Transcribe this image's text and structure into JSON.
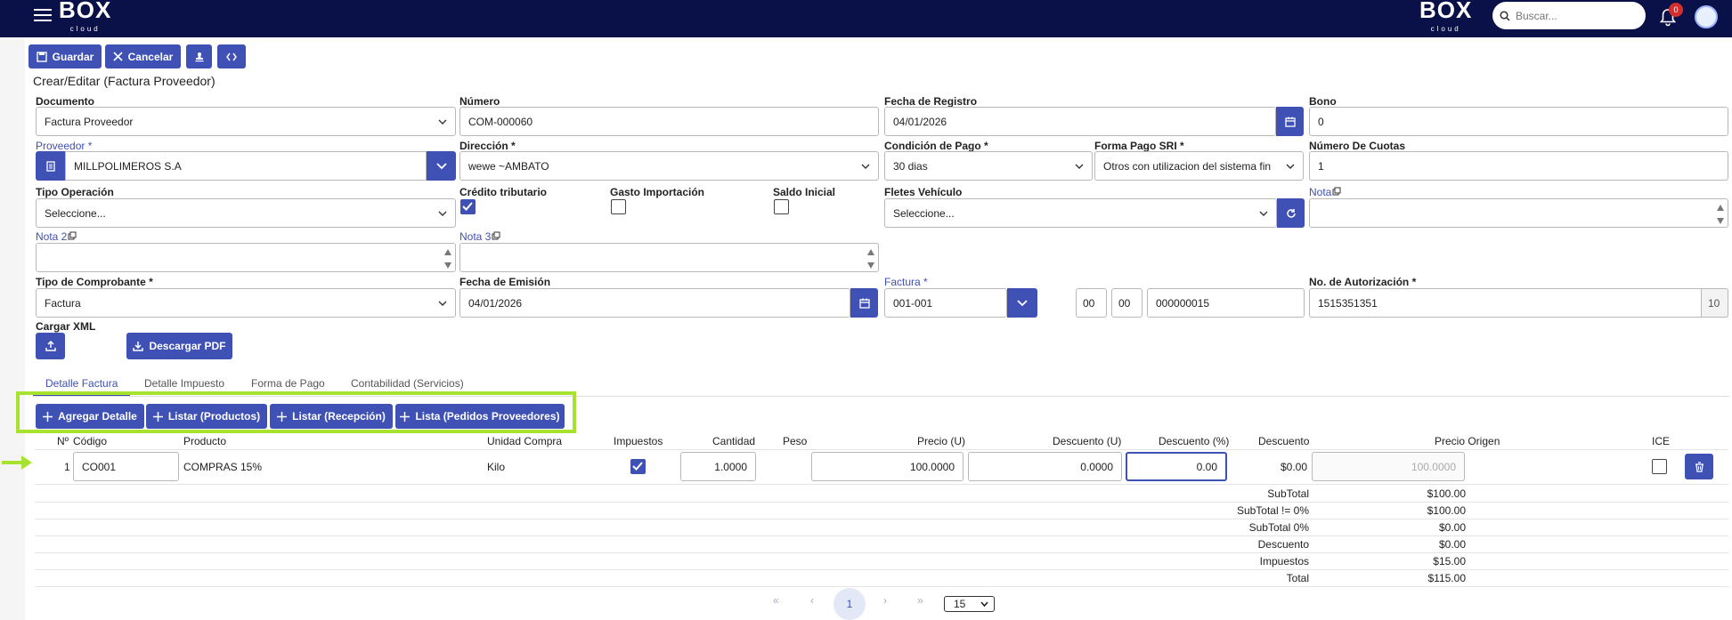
{
  "header": {
    "logo": "BOX",
    "logo_sub": "cloud",
    "logo2": "BOX",
    "logo2_sub": "cloud",
    "search_placeholder": "Buscar...",
    "notif_count": "0"
  },
  "toolbar": {
    "save": "Guardar",
    "cancel": "Cancelar"
  },
  "page_title": "Crear/Editar (Factura Proveedor)",
  "form": {
    "documento": {
      "label": "Documento",
      "value": "Factura Proveedor"
    },
    "numero": {
      "label": "Número",
      "value": "COM-000060"
    },
    "fecha_registro": {
      "label": "Fecha de Registro",
      "value": "04/01/2026"
    },
    "bono": {
      "label": "Bono",
      "value": "0"
    },
    "proveedor": {
      "label": "Proveedor",
      "req": "*",
      "value": "MILLPOLIMEROS S.A"
    },
    "direccion": {
      "label": "Dirección",
      "req": "*",
      "value": "wewe ~AMBATO"
    },
    "condicion_pago": {
      "label": "Condición de Pago",
      "req": "*",
      "value": "30 dias"
    },
    "forma_pago_sri": {
      "label": "Forma Pago SRI",
      "req": "*",
      "value": "Otros con utilizacion del sistema fin"
    },
    "num_cuotas": {
      "label": "Número De Cuotas",
      "value": "1"
    },
    "tipo_operacion": {
      "label": "Tipo Operación",
      "value": "Seleccione..."
    },
    "credito_tributario": {
      "label": "Crédito tributario",
      "checked": true
    },
    "gasto_importacion": {
      "label": "Gasto Importación",
      "checked": false
    },
    "saldo_inicial": {
      "label": "Saldo Inicial",
      "checked": false
    },
    "fletes_vehiculo": {
      "label": "Fletes Vehículo",
      "value": "Seleccione..."
    },
    "nota": {
      "label": "Nota"
    },
    "nota2": {
      "label": "Nota 2"
    },
    "nota3": {
      "label": "Nota 3"
    },
    "tipo_comprobante": {
      "label": "Tipo de Comprobante",
      "req": "*",
      "value": "Factura"
    },
    "fecha_emision": {
      "label": "Fecha de Emisión",
      "value": "04/01/2026"
    },
    "factura": {
      "label": "Factura",
      "req": "*",
      "value": "001-001",
      "p1": "00",
      "p2": "00",
      "secuencial": "000000015"
    },
    "autorizacion": {
      "label": "No. de Autorización",
      "req": "*",
      "value": "1515351351",
      "count": "10"
    },
    "cargar_xml": {
      "label": "Cargar XML"
    },
    "descargar_pdf": "Descargar PDF"
  },
  "tabs": [
    "Detalle Factura",
    "Detalle Impuesto",
    "Forma de Pago",
    "Contabilidad (Servicios)"
  ],
  "actions": [
    "Agregar Detalle",
    "Listar (Productos)",
    "Listar (Recepción)",
    "Lista (Pedidos Proveedores)"
  ],
  "table": {
    "headers": {
      "num": "Nº",
      "codigo": "Código",
      "producto": "Producto",
      "unidad": "Unidad Compra",
      "impuestos": "Impuestos",
      "cantidad": "Cantidad",
      "peso": "Peso",
      "precio": "Precio (U)",
      "desc_u": "Descuento (U)",
      "desc_p": "Descuento (%)",
      "descuento": "Descuento",
      "precio_origen": "Precio Origen",
      "ice": "ICE"
    },
    "rows": [
      {
        "num": "1",
        "codigo": "CO001",
        "producto": "COMPRAS 15%",
        "unidad": "Kilo",
        "impuestos": true,
        "cantidad": "1.0000",
        "precio": "100.0000",
        "desc_u": "0.0000",
        "desc_p": "0.00",
        "descuento": "$0.00",
        "precio_origen": "100.0000",
        "ice": false
      }
    ]
  },
  "totals": [
    {
      "label": "SubTotal",
      "value": "$100.00"
    },
    {
      "label": "SubTotal != 0%",
      "value": "$100.00"
    },
    {
      "label": "SubTotal 0%",
      "value": "$0.00"
    },
    {
      "label": "Descuento",
      "value": "$0.00"
    },
    {
      "label": "Impuestos",
      "value": "$15.00"
    },
    {
      "label": "Total",
      "value": "$115.00"
    }
  ],
  "pager": {
    "page": "1",
    "size": "15"
  },
  "colors": {
    "brand": "#0a1148",
    "accent": "#3f51b5",
    "highlight": "#a6e22e"
  }
}
